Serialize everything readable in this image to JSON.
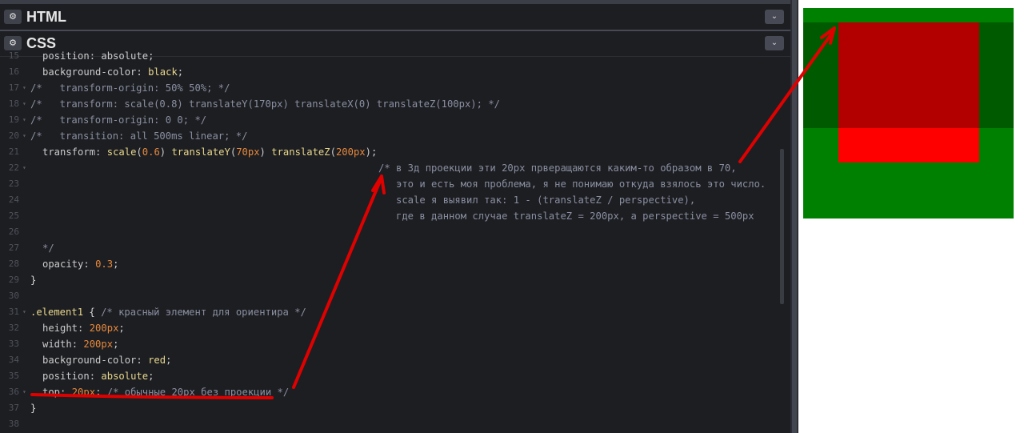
{
  "html_panel": {
    "title": "HTML",
    "gear_glyph": "⚙",
    "collapse_glyph": "⌄"
  },
  "css_panel": {
    "title": "CSS",
    "gear_glyph": "⚙",
    "collapse_glyph": "⌄"
  },
  "code": {
    "l15": {
      "n": "15",
      "t": "position: absolute;"
    },
    "l16": {
      "n": "16",
      "prop": "background-color",
      "val": "black"
    },
    "l17": {
      "n": "17",
      "t": "/*   transform-origin: 50% 50%; */"
    },
    "l18": {
      "n": "18",
      "t": "/*   transform: scale(0.8) translateY(170px) translateX(0) translateZ(100px); */"
    },
    "l19": {
      "n": "19",
      "t": "/*   transform-origin: 0 0; */"
    },
    "l20": {
      "n": "20",
      "t": "/*   transition: all 500ms linear; */"
    },
    "l21": {
      "n": "21",
      "prop": "transform",
      "f1": "scale",
      "a1": "0.6",
      "f2": "translateY",
      "a2": "70px",
      "f3": "translateZ",
      "a3": "200px"
    },
    "l22": {
      "n": "22",
      "t": "/* в 3д проекции эти 20px прверащаются каким-то образом в 70,"
    },
    "l23": {
      "n": "23",
      "t": "   это и есть моя проблема, я не понимаю откуда взялось это число."
    },
    "l24": {
      "n": "24",
      "t": "   scale я выявил так: 1 - (translateZ / perspective),"
    },
    "l25": {
      "n": "25",
      "t": "   где в данном случае translateZ = 200px, а perspective = 500px"
    },
    "l26": {
      "n": "26"
    },
    "l27": {
      "n": "27",
      "t": "*/"
    },
    "l28": {
      "n": "28",
      "prop": "opacity",
      "val": "0.3"
    },
    "l29": {
      "n": "29",
      "t": "}"
    },
    "l30": {
      "n": "30"
    },
    "l31": {
      "n": "31",
      "sel": ".element1",
      "open": "{",
      "cm": "/* красный элемент для ориентира */"
    },
    "l32": {
      "n": "32",
      "prop": "height",
      "val": "200px"
    },
    "l33": {
      "n": "33",
      "prop": "width",
      "val": "200px"
    },
    "l34": {
      "n": "34",
      "prop": "background-color",
      "val": "red"
    },
    "l35": {
      "n": "35",
      "prop": "position",
      "val": "absolute"
    },
    "l36": {
      "n": "36",
      "prop": "top",
      "val": "20px",
      "cm": "/* обычные 20px без проекции */"
    },
    "l37": {
      "n": "37",
      "t": "}"
    },
    "l38": {
      "n": "38"
    }
  },
  "colors": {
    "arrow": "#e00000",
    "preview_green": "#008000",
    "preview_red": "#ff0000"
  }
}
